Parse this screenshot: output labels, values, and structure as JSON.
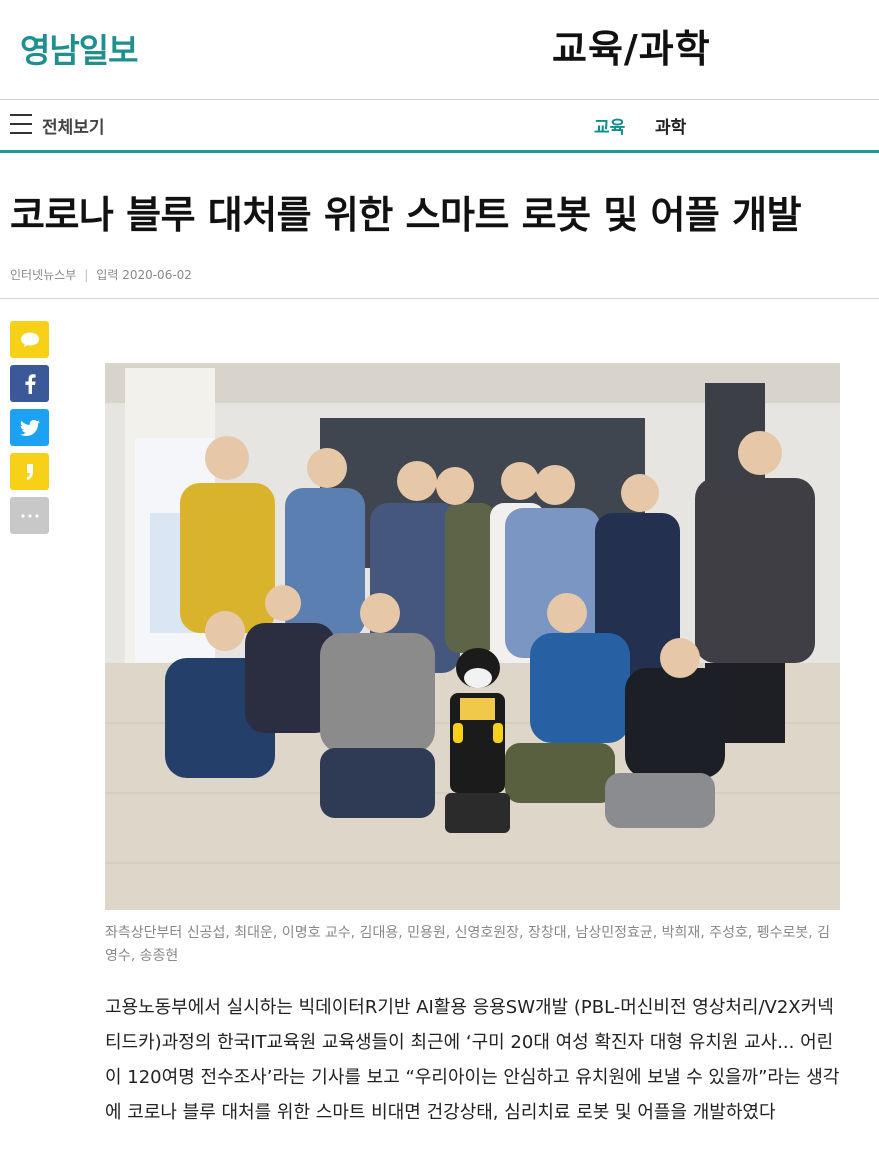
{
  "header": {
    "logo_text": "영남일보",
    "section_title": "교육/과학"
  },
  "nav": {
    "menu_label": "전체보기",
    "items": [
      {
        "label": "교육",
        "active": true
      },
      {
        "label": "과학",
        "active": false
      }
    ],
    "accent_color": "#1c9a96"
  },
  "article": {
    "headline": "코로나 블루 대처를 위한 스마트 로봇 및 어플 개발",
    "byline": {
      "author": "인터넷뉴스부",
      "date_label": "입력 2020-06-02"
    },
    "share_buttons": [
      {
        "icon": "speech-bubble-icon",
        "color": "#f7d117"
      },
      {
        "icon": "facebook-icon",
        "color": "#3b5998"
      },
      {
        "icon": "twitter-icon",
        "color": "#1da1f2"
      },
      {
        "icon": "kakaostory-icon",
        "color": "#f7d117"
      },
      {
        "icon": "more-icon",
        "color": "#c8c8c8"
      }
    ],
    "photo_caption": "좌측상단부터 신공섭, 최대운, 이명호 교수, 김대용, 민용원, 신영호원장, 장창대, 남상민정효균, 박희재, 주성호, 펭수로봇, 김영수, 송종현",
    "body_text": "고용노동부에서 실시하는 빅데이터R기반 AI활용 응용SW개발 (PBL-머신비전 영상처리/V2X커넥티드카)과정의 한국IT교육원 교육생들이 최근에 ‘구미 20대 여성 확진자 대형 유치원 교사... 어린이 120여명 전수조사’라는 기사를 보고 “우리아이는 안심하고 유치원에 보낼 수 있을까”라는 생각에 코로나 블루 대처를 위한 스마트 비대면 건강상태, 심리치료 로봇 및 어플을 개발하였다"
  }
}
